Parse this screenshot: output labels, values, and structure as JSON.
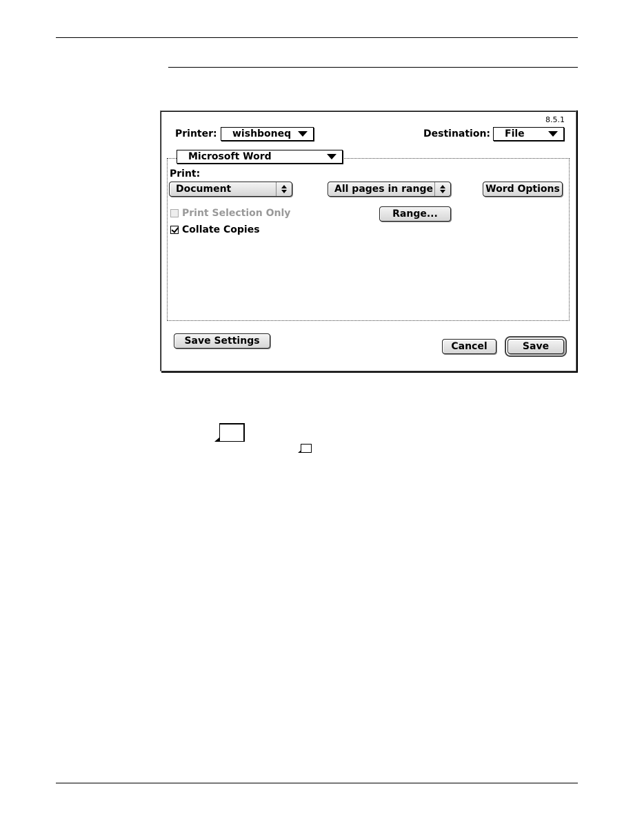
{
  "dialog": {
    "version": "8.5.1",
    "printer_label": "Printer:",
    "printer_value": "wishboneq",
    "destination_label": "Destination:",
    "destination_value": "File",
    "panel_popup_value": "Microsoft Word",
    "print_label": "Print:",
    "print_select_value": "Document",
    "pages_select_value": "All pages in range",
    "word_options_button": "Word Options",
    "range_button": "Range...",
    "print_selection_only": {
      "label": "Print Selection Only",
      "checked": false,
      "enabled": false
    },
    "collate_copies": {
      "label": "Collate Copies",
      "checked": true,
      "enabled": true
    },
    "save_settings_button": "Save Settings",
    "cancel_button": "Cancel",
    "save_button": "Save"
  }
}
